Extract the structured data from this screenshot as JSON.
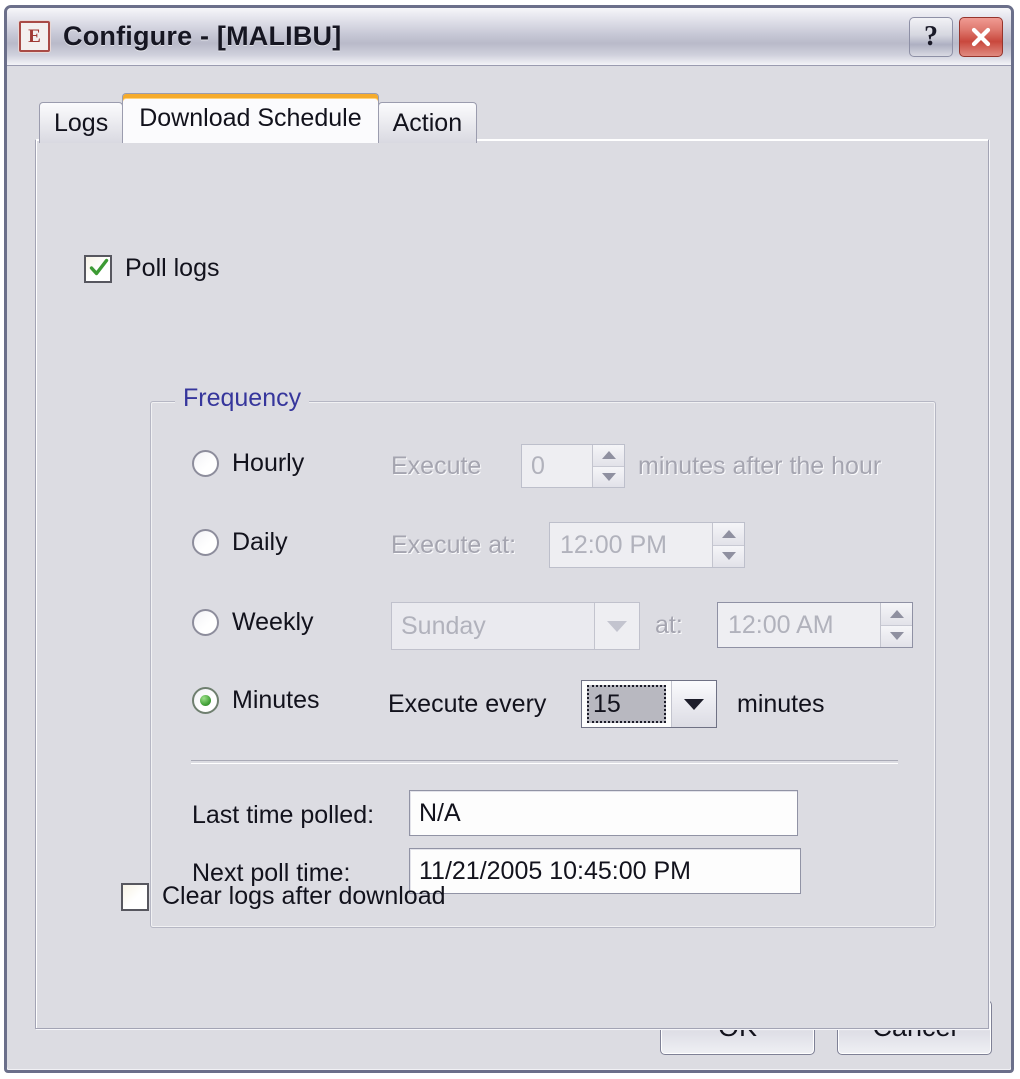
{
  "window": {
    "title": "Configure - [MALIBU]",
    "app_icon": "application-e-icon",
    "help_button": "?",
    "close_button": "✕"
  },
  "tabs": [
    {
      "label": "Logs",
      "active": false
    },
    {
      "label": "Download Schedule",
      "active": true
    },
    {
      "label": "Action",
      "active": false
    }
  ],
  "page": {
    "poll_logs": {
      "label": "Poll logs",
      "checked": true
    },
    "frequency": {
      "title": "Frequency",
      "options": [
        {
          "id": "hourly",
          "label": "Hourly",
          "selected": false,
          "enabled": false,
          "prefix_label": "Execute",
          "value": "0",
          "suffix_label": "minutes after the hour"
        },
        {
          "id": "daily",
          "label": "Daily",
          "selected": false,
          "enabled": false,
          "prefix_label": "Execute at:",
          "value": "12:00 PM",
          "suffix_label": ""
        },
        {
          "id": "weekly",
          "label": "Weekly",
          "selected": false,
          "enabled": false,
          "day_value": "Sunday",
          "mid_label": "at:",
          "time_value": "12:00 AM"
        },
        {
          "id": "minutes",
          "label": "Minutes",
          "selected": true,
          "enabled": true,
          "prefix_label": "Execute every",
          "value": "15",
          "suffix_label": "minutes"
        }
      ],
      "last_time_polled_label": "Last time polled:",
      "last_time_polled_value": "N/A",
      "next_poll_time_label": "Next poll time:",
      "next_poll_time_value": "11/21/2005 10:45:00 PM"
    },
    "clear_logs": {
      "label": "Clear logs after download",
      "checked": false
    }
  },
  "footer": {
    "ok_label": "OK",
    "cancel_label": "Cancel"
  },
  "colors": {
    "group_title": "#36369c",
    "active_tab_accent": "#f5ab2c",
    "radio_selected": "#45a33a",
    "check_mark": "#3c9a33",
    "close_button": "#c9483d"
  }
}
